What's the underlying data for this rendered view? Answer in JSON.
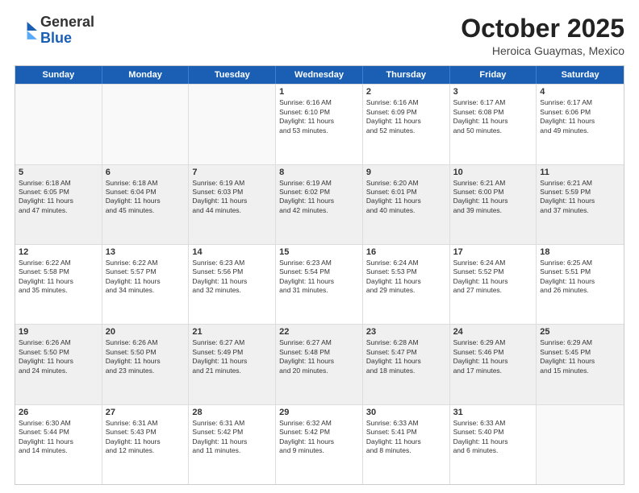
{
  "logo": {
    "general": "General",
    "blue": "Blue"
  },
  "header": {
    "month": "October 2025",
    "location": "Heroica Guaymas, Mexico"
  },
  "days": [
    "Sunday",
    "Monday",
    "Tuesday",
    "Wednesday",
    "Thursday",
    "Friday",
    "Saturday"
  ],
  "weeks": [
    [
      {
        "day": "",
        "empty": true
      },
      {
        "day": "",
        "empty": true
      },
      {
        "day": "",
        "empty": true
      },
      {
        "day": "1",
        "lines": [
          "Sunrise: 6:16 AM",
          "Sunset: 6:10 PM",
          "Daylight: 11 hours",
          "and 53 minutes."
        ]
      },
      {
        "day": "2",
        "lines": [
          "Sunrise: 6:16 AM",
          "Sunset: 6:09 PM",
          "Daylight: 11 hours",
          "and 52 minutes."
        ]
      },
      {
        "day": "3",
        "lines": [
          "Sunrise: 6:17 AM",
          "Sunset: 6:08 PM",
          "Daylight: 11 hours",
          "and 50 minutes."
        ]
      },
      {
        "day": "4",
        "lines": [
          "Sunrise: 6:17 AM",
          "Sunset: 6:06 PM",
          "Daylight: 11 hours",
          "and 49 minutes."
        ]
      }
    ],
    [
      {
        "day": "5",
        "lines": [
          "Sunrise: 6:18 AM",
          "Sunset: 6:05 PM",
          "Daylight: 11 hours",
          "and 47 minutes."
        ]
      },
      {
        "day": "6",
        "lines": [
          "Sunrise: 6:18 AM",
          "Sunset: 6:04 PM",
          "Daylight: 11 hours",
          "and 45 minutes."
        ]
      },
      {
        "day": "7",
        "lines": [
          "Sunrise: 6:19 AM",
          "Sunset: 6:03 PM",
          "Daylight: 11 hours",
          "and 44 minutes."
        ]
      },
      {
        "day": "8",
        "lines": [
          "Sunrise: 6:19 AM",
          "Sunset: 6:02 PM",
          "Daylight: 11 hours",
          "and 42 minutes."
        ]
      },
      {
        "day": "9",
        "lines": [
          "Sunrise: 6:20 AM",
          "Sunset: 6:01 PM",
          "Daylight: 11 hours",
          "and 40 minutes."
        ]
      },
      {
        "day": "10",
        "lines": [
          "Sunrise: 6:21 AM",
          "Sunset: 6:00 PM",
          "Daylight: 11 hours",
          "and 39 minutes."
        ]
      },
      {
        "day": "11",
        "lines": [
          "Sunrise: 6:21 AM",
          "Sunset: 5:59 PM",
          "Daylight: 11 hours",
          "and 37 minutes."
        ]
      }
    ],
    [
      {
        "day": "12",
        "lines": [
          "Sunrise: 6:22 AM",
          "Sunset: 5:58 PM",
          "Daylight: 11 hours",
          "and 35 minutes."
        ]
      },
      {
        "day": "13",
        "lines": [
          "Sunrise: 6:22 AM",
          "Sunset: 5:57 PM",
          "Daylight: 11 hours",
          "and 34 minutes."
        ]
      },
      {
        "day": "14",
        "lines": [
          "Sunrise: 6:23 AM",
          "Sunset: 5:56 PM",
          "Daylight: 11 hours",
          "and 32 minutes."
        ]
      },
      {
        "day": "15",
        "lines": [
          "Sunrise: 6:23 AM",
          "Sunset: 5:54 PM",
          "Daylight: 11 hours",
          "and 31 minutes."
        ]
      },
      {
        "day": "16",
        "lines": [
          "Sunrise: 6:24 AM",
          "Sunset: 5:53 PM",
          "Daylight: 11 hours",
          "and 29 minutes."
        ]
      },
      {
        "day": "17",
        "lines": [
          "Sunrise: 6:24 AM",
          "Sunset: 5:52 PM",
          "Daylight: 11 hours",
          "and 27 minutes."
        ]
      },
      {
        "day": "18",
        "lines": [
          "Sunrise: 6:25 AM",
          "Sunset: 5:51 PM",
          "Daylight: 11 hours",
          "and 26 minutes."
        ]
      }
    ],
    [
      {
        "day": "19",
        "lines": [
          "Sunrise: 6:26 AM",
          "Sunset: 5:50 PM",
          "Daylight: 11 hours",
          "and 24 minutes."
        ]
      },
      {
        "day": "20",
        "lines": [
          "Sunrise: 6:26 AM",
          "Sunset: 5:50 PM",
          "Daylight: 11 hours",
          "and 23 minutes."
        ]
      },
      {
        "day": "21",
        "lines": [
          "Sunrise: 6:27 AM",
          "Sunset: 5:49 PM",
          "Daylight: 11 hours",
          "and 21 minutes."
        ]
      },
      {
        "day": "22",
        "lines": [
          "Sunrise: 6:27 AM",
          "Sunset: 5:48 PM",
          "Daylight: 11 hours",
          "and 20 minutes."
        ]
      },
      {
        "day": "23",
        "lines": [
          "Sunrise: 6:28 AM",
          "Sunset: 5:47 PM",
          "Daylight: 11 hours",
          "and 18 minutes."
        ]
      },
      {
        "day": "24",
        "lines": [
          "Sunrise: 6:29 AM",
          "Sunset: 5:46 PM",
          "Daylight: 11 hours",
          "and 17 minutes."
        ]
      },
      {
        "day": "25",
        "lines": [
          "Sunrise: 6:29 AM",
          "Sunset: 5:45 PM",
          "Daylight: 11 hours",
          "and 15 minutes."
        ]
      }
    ],
    [
      {
        "day": "26",
        "lines": [
          "Sunrise: 6:30 AM",
          "Sunset: 5:44 PM",
          "Daylight: 11 hours",
          "and 14 minutes."
        ]
      },
      {
        "day": "27",
        "lines": [
          "Sunrise: 6:31 AM",
          "Sunset: 5:43 PM",
          "Daylight: 11 hours",
          "and 12 minutes."
        ]
      },
      {
        "day": "28",
        "lines": [
          "Sunrise: 6:31 AM",
          "Sunset: 5:42 PM",
          "Daylight: 11 hours",
          "and 11 minutes."
        ]
      },
      {
        "day": "29",
        "lines": [
          "Sunrise: 6:32 AM",
          "Sunset: 5:42 PM",
          "Daylight: 11 hours",
          "and 9 minutes."
        ]
      },
      {
        "day": "30",
        "lines": [
          "Sunrise: 6:33 AM",
          "Sunset: 5:41 PM",
          "Daylight: 11 hours",
          "and 8 minutes."
        ]
      },
      {
        "day": "31",
        "lines": [
          "Sunrise: 6:33 AM",
          "Sunset: 5:40 PM",
          "Daylight: 11 hours",
          "and 6 minutes."
        ]
      },
      {
        "day": "",
        "empty": true
      }
    ]
  ]
}
